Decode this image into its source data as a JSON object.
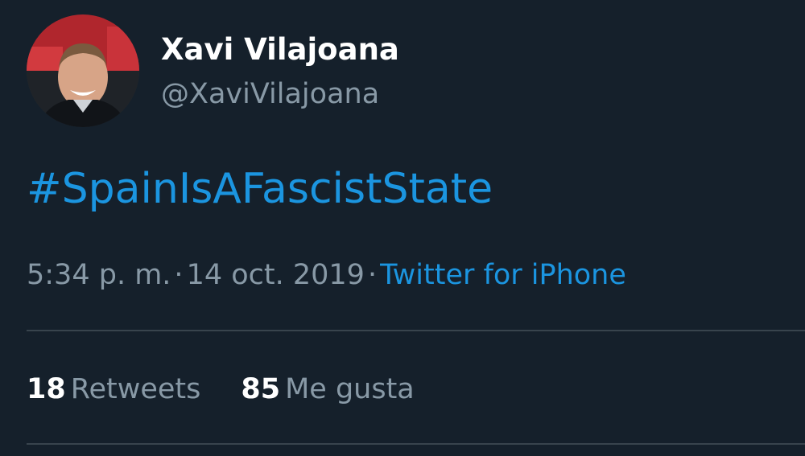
{
  "user": {
    "display_name": "Xavi Vilajoana",
    "username": "@XaviVilajoana"
  },
  "tweet": {
    "text": "#SpainIsAFascistState",
    "time": "5:34 p. m.",
    "date": "14 oct. 2019",
    "separator": "·",
    "source": "Twitter for iPhone"
  },
  "stats": {
    "retweets_count": "18",
    "retweets_label": "Retweets",
    "likes_count": "85",
    "likes_label": "Me gusta"
  },
  "colors": {
    "background": "#15202b",
    "link": "#1b95e0",
    "secondary_text": "#8899a6",
    "divider": "#38444d"
  }
}
